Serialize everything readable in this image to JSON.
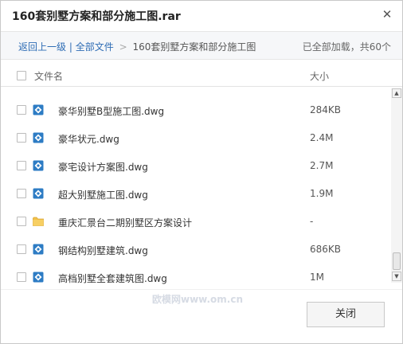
{
  "window": {
    "title": "160套别墅方案和部分施工图.rar"
  },
  "breadcrumb": {
    "back_label": "返回上一级",
    "sep1": "|",
    "all_files_label": "全部文件",
    "arrow": ">",
    "current": "160套别墅方案和部分施工图",
    "status": "已全部加载，共60个"
  },
  "columns": {
    "name": "文件名",
    "size": "大小"
  },
  "files": [
    {
      "name": "豪华别墅B型施工图.dwg",
      "size": "284KB",
      "icon": "dwg-file-icon"
    },
    {
      "name": "豪华状元.dwg",
      "size": "2.4M",
      "icon": "dwg-file-icon"
    },
    {
      "name": "豪宅设计方案图.dwg",
      "size": "2.7M",
      "icon": "dwg-file-icon"
    },
    {
      "name": "超大别墅施工图.dwg",
      "size": "1.9M",
      "icon": "dwg-file-icon"
    },
    {
      "name": "重庆汇景台二期别墅区方案设计",
      "size": "-",
      "icon": "folder-icon"
    },
    {
      "name": "钢结构别墅建筑.dwg",
      "size": "686KB",
      "icon": "dwg-file-icon"
    },
    {
      "name": "高档别墅全套建筑图.dwg",
      "size": "1M",
      "icon": "dwg-file-icon"
    }
  ],
  "footer": {
    "watermark": "欧模网www.om.cn",
    "close_label": "关闭"
  },
  "colors": {
    "link": "#2f6db5",
    "file_icon": "#2d7cc4",
    "folder_icon": "#f2c14a"
  }
}
